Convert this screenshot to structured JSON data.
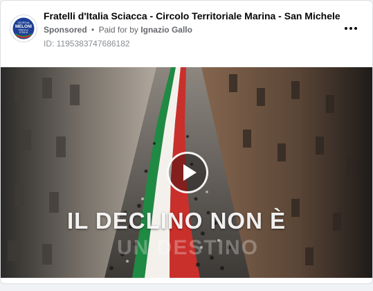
{
  "post": {
    "page_name": "Fratelli d'Italia Sciacca - Circolo Territoriale Marina - San Michele",
    "sponsored_label": "Sponsored",
    "separator": "•",
    "paid_for_prefix": "Paid for by",
    "payer": "Ignazio Gallo",
    "ad_id": "ID: 1195383747686182",
    "avatar": {
      "icon": "fratelli-ditalia-logo-icon",
      "logo_line1": "GIORGIA",
      "logo_line2": "MELONI",
      "logo_line3": "FRATELLI",
      "logo_line4": "D'ITALIA"
    },
    "menu_icon": "more-options-icon"
  },
  "video": {
    "overlay_line1": "IL DECLINO NON È",
    "overlay_line2": "UN DESTINO",
    "play_icon": "play-icon"
  },
  "colors": {
    "accent_blue": "#1c3f94",
    "flag_green": "#1f8a43",
    "flag_white": "#f4f1ec",
    "flag_red": "#c9302c",
    "meta_grey": "#65676b"
  }
}
